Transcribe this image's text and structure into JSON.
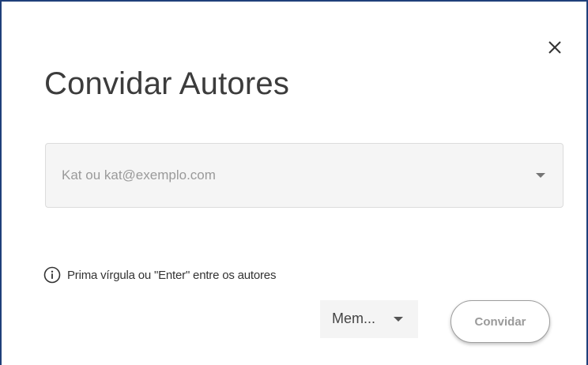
{
  "dialog": {
    "title": "Convidar Autores",
    "close_icon": "close-icon"
  },
  "author_input": {
    "placeholder": "Kat ou kat@exemplo.com",
    "value": "",
    "dropdown_icon": "chevron-down-icon"
  },
  "hint": {
    "icon": "info-icon",
    "text": "Prima vírgula ou \"Enter\" entre os autores"
  },
  "role_select": {
    "selected": "Mem...",
    "dropdown_icon": "chevron-down-icon"
  },
  "actions": {
    "invite_label": "Convidar"
  },
  "colors": {
    "window_border": "#1f3f7a",
    "field_background": "#f5f5f5",
    "disabled_text": "#9a9a9a"
  }
}
